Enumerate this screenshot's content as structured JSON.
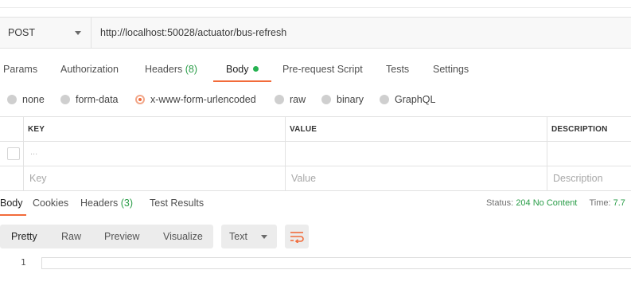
{
  "request": {
    "method": "POST",
    "url": "http://localhost:50028/actuator/bus-refresh"
  },
  "request_tabs": [
    {
      "label": "Params"
    },
    {
      "label": "Authorization"
    },
    {
      "label": "Headers",
      "count": "(8)"
    },
    {
      "label": "Body",
      "active": true,
      "indicator": "green-dot"
    },
    {
      "label": "Pre-request Script"
    },
    {
      "label": "Tests"
    },
    {
      "label": "Settings"
    }
  ],
  "body_types": [
    {
      "label": "none",
      "selected": false
    },
    {
      "label": "form-data",
      "selected": false
    },
    {
      "label": "x-www-form-urlencoded",
      "selected": true
    },
    {
      "label": "raw",
      "selected": false
    },
    {
      "label": "binary",
      "selected": false
    },
    {
      "label": "GraphQL",
      "selected": false
    }
  ],
  "kv_table": {
    "headers": [
      "KEY",
      "VALUE",
      "DESCRIPTION"
    ],
    "row_ellipsis": "...",
    "placeholders": {
      "key": "Key",
      "value": "Value",
      "description": "Description"
    }
  },
  "response_tabs": [
    {
      "label": "Body",
      "active": true
    },
    {
      "label": "Cookies"
    },
    {
      "label": "Headers",
      "count": "(3)"
    },
    {
      "label": "Test Results"
    }
  ],
  "response_status": {
    "status_label": "Status:",
    "status_value": "204 No Content",
    "time_label": "Time:",
    "time_value": "7.7"
  },
  "view_modes": [
    "Pretty",
    "Raw",
    "Preview",
    "Visualize"
  ],
  "active_view_mode": "Pretty",
  "format": "Text",
  "wrap_icon": "wrap-lines-icon",
  "editor": {
    "line_numbers": [
      "1"
    ]
  },
  "colors": {
    "accent": "#f26b3a",
    "success": "#2a9d48",
    "dot": "#26b251"
  }
}
